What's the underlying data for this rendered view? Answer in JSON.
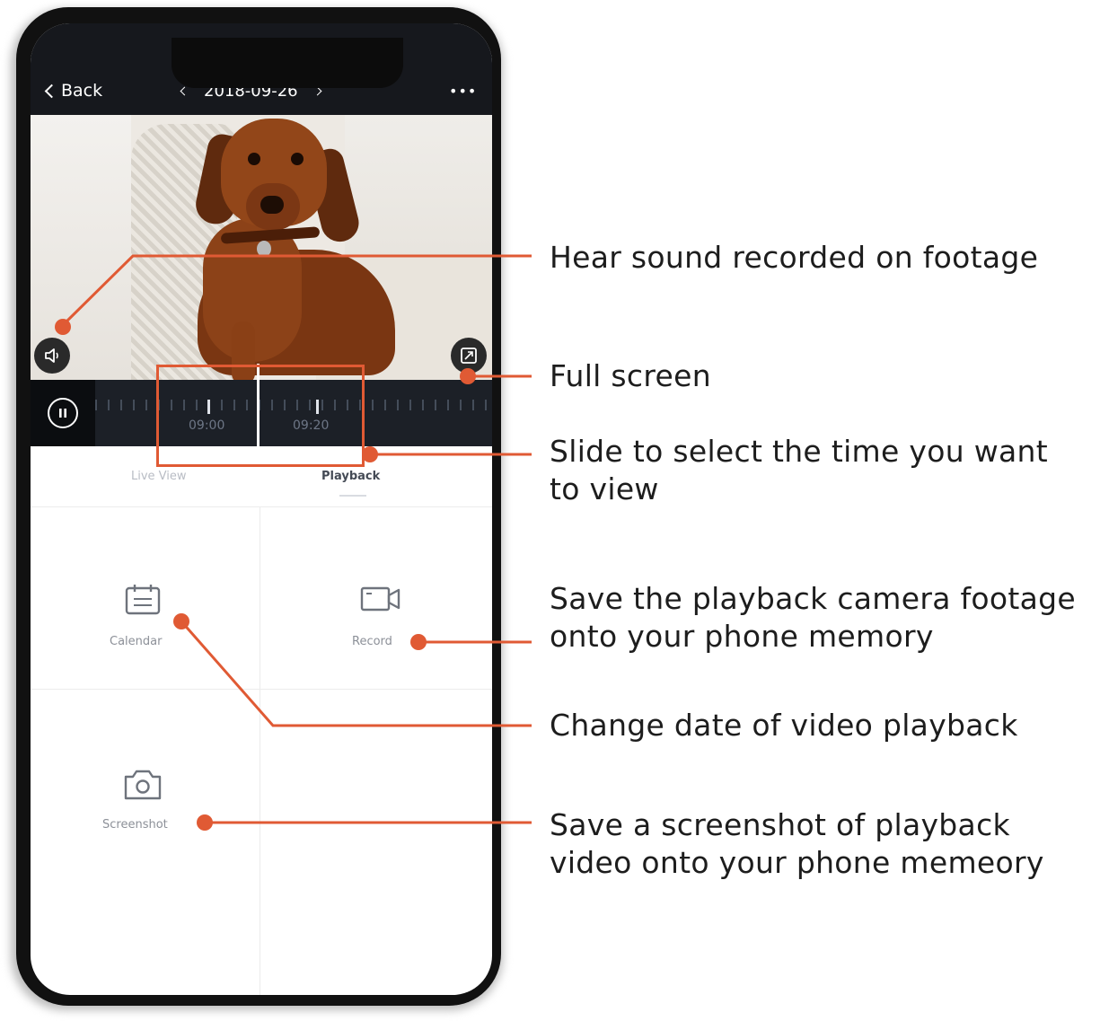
{
  "app": {
    "back_label": "Back",
    "date": "2018-09-26",
    "more_label": "•••"
  },
  "timeline": {
    "times": [
      "09:00",
      "09:20"
    ]
  },
  "mode_tabs": {
    "live_view": "Live View",
    "playback": "Playback",
    "active": "playback"
  },
  "functions": {
    "calendar": "Calendar",
    "record": "Record",
    "screenshot": "Screenshot"
  },
  "annotations": {
    "sound": "Hear sound recorded on footage",
    "fullscreen": "Full screen",
    "slide_line1": "Slide to select the time you want",
    "slide_line2": "to view",
    "record_line1": "Save the playback camera footage",
    "record_line2": "onto your phone memory",
    "calendar": "Change date of video playback",
    "screenshot_line1": "Save a screenshot of playback",
    "screenshot_line2": "video onto your phone memeory"
  },
  "colors": {
    "accent": "#e05a34",
    "nav_bg": "#16181d",
    "timeline_bg": "#1c2027"
  },
  "icons": [
    "back-chevron-icon",
    "prev-date-icon",
    "next-date-icon",
    "more-icon",
    "speaker-icon",
    "fullscreen-icon",
    "pause-icon",
    "calendar-icon",
    "record-camera-icon",
    "screenshot-camera-icon"
  ]
}
